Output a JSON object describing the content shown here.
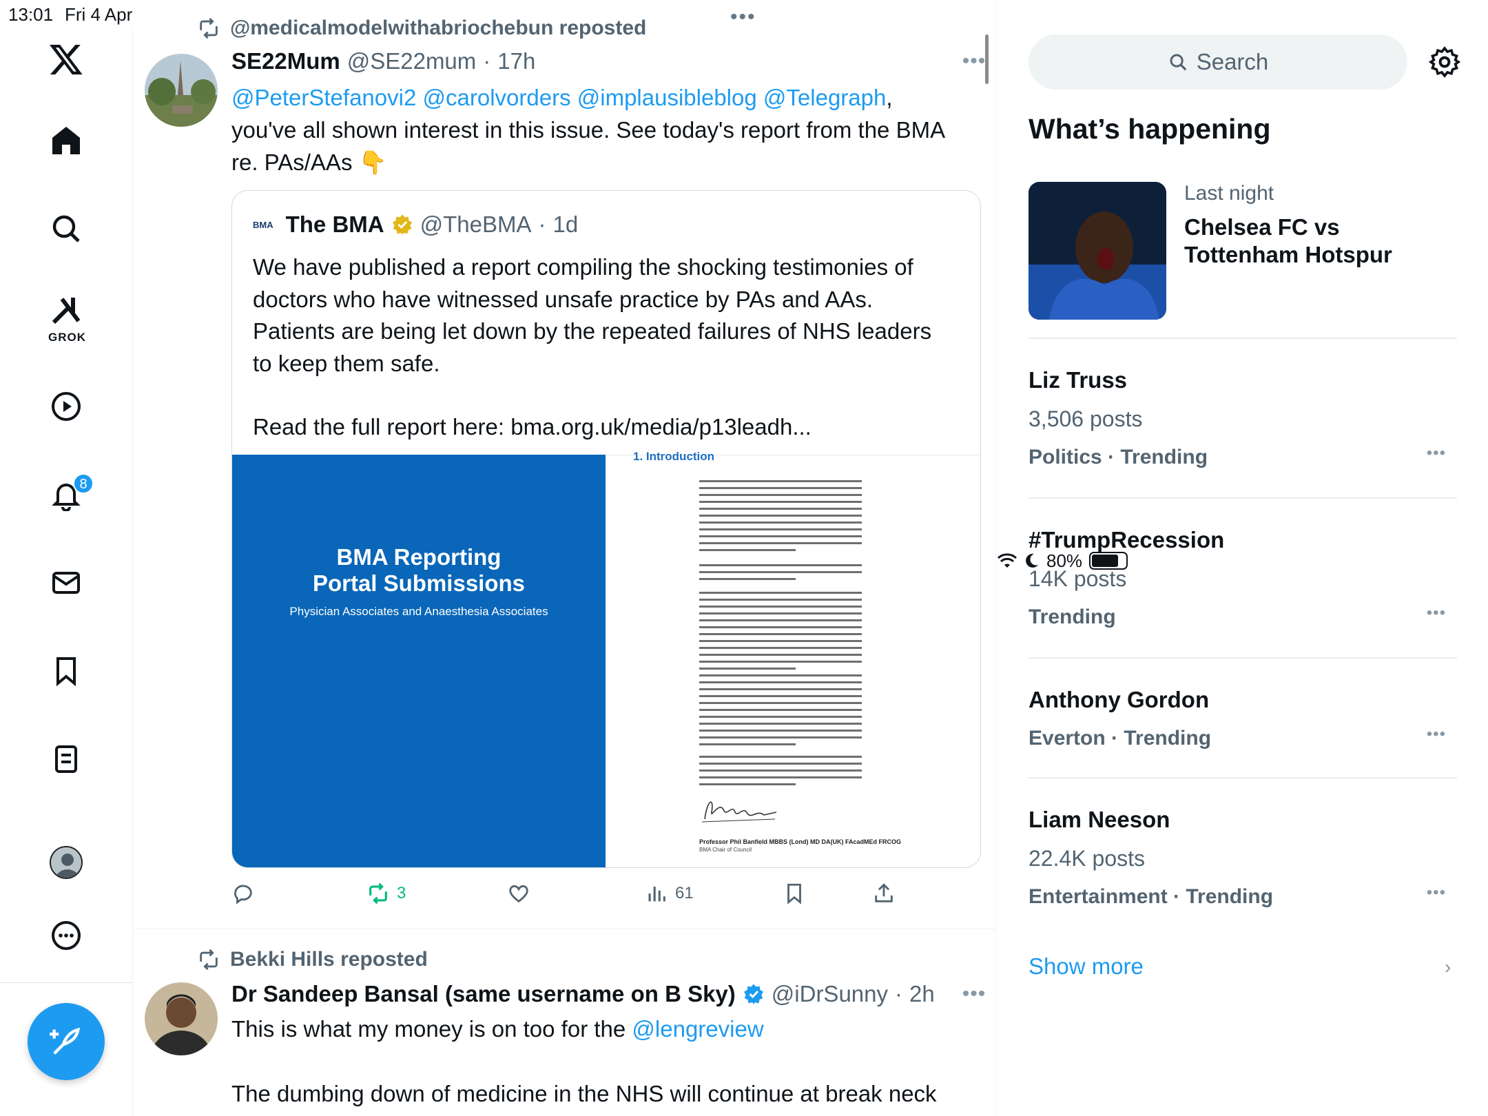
{
  "status_bar": {
    "time": "13:01",
    "date": "Fri 4 Apr",
    "battery": "80%"
  },
  "nav": {
    "grok_label": "GROK",
    "notification_count": "8"
  },
  "feed": {
    "tweet1": {
      "repost_by": "@medicalmodelwithabriochebun reposted",
      "name": "SE22Mum",
      "handle": "@SE22mum",
      "time": "17h",
      "mentions": [
        "@PeterStefanovi2",
        "@carolvorders",
        "@implausibleblog",
        "@Telegraph"
      ],
      "text_after_mentions": ",",
      "text_line2": "you've all shown interest in this issue. See today's report from the BMA",
      "text_line3": "re. PAs/AAs 👇",
      "quote": {
        "logo_text": "BMA",
        "name": "The BMA",
        "handle": "@TheBMA",
        "time": "1d",
        "text": "We have published a report compiling the shocking testimonies of doctors who have witnessed unsafe practice by PAs and AAs. Patients are being let down by the repeated failures of NHS leaders to keep them safe.",
        "link_line": "Read the full report here: bma.org.uk/media/p13leadh...",
        "image": {
          "cover_title_line1": "BMA Reporting",
          "cover_title_line2": "Portal Submissions",
          "cover_subtitle": "Physician Associates and Anaesthesia Associates",
          "doc_heading": "1.   Introduction",
          "doc_signatory": "Professor Phil Banfield MBBS (Lond) MD DA(UK) FAcadMEd FRCOG",
          "doc_signatory_role": "BMA Chair of Council"
        }
      },
      "actions": {
        "retweets": "3",
        "views": "61"
      }
    },
    "tweet2": {
      "repost_by": "Bekki Hills reposted",
      "name": "Dr Sandeep Bansal (same username on B Sky)",
      "handle": "@iDrSunny",
      "time": "2h",
      "text_line1": "This is what my money is on too for the ",
      "mention": "@lengreview",
      "text_line3": "The dumbing down of medicine in the NHS will continue at break neck"
    }
  },
  "sidebar": {
    "search_placeholder": "Search",
    "title": "What’s happening",
    "featured": {
      "meta": "Last night",
      "title": "Chelsea FC vs Tottenham Hotspur"
    },
    "trends": [
      {
        "name": "Liz Truss",
        "posts": "3,506 posts",
        "category": "Politics · Trending"
      },
      {
        "name": "#TrumpRecession",
        "posts": "14K posts",
        "category": "Trending"
      },
      {
        "name": "Anthony Gordon",
        "posts": "",
        "category": "Everton · Trending"
      },
      {
        "name": "Liam Neeson",
        "posts": "22.4K posts",
        "category": "Entertainment · Trending"
      }
    ],
    "show_more": "Show more"
  },
  "colors": {
    "accent": "#1d9bf0",
    "retweet_green": "#00ba7c",
    "bma_blue": "#0966b8"
  }
}
